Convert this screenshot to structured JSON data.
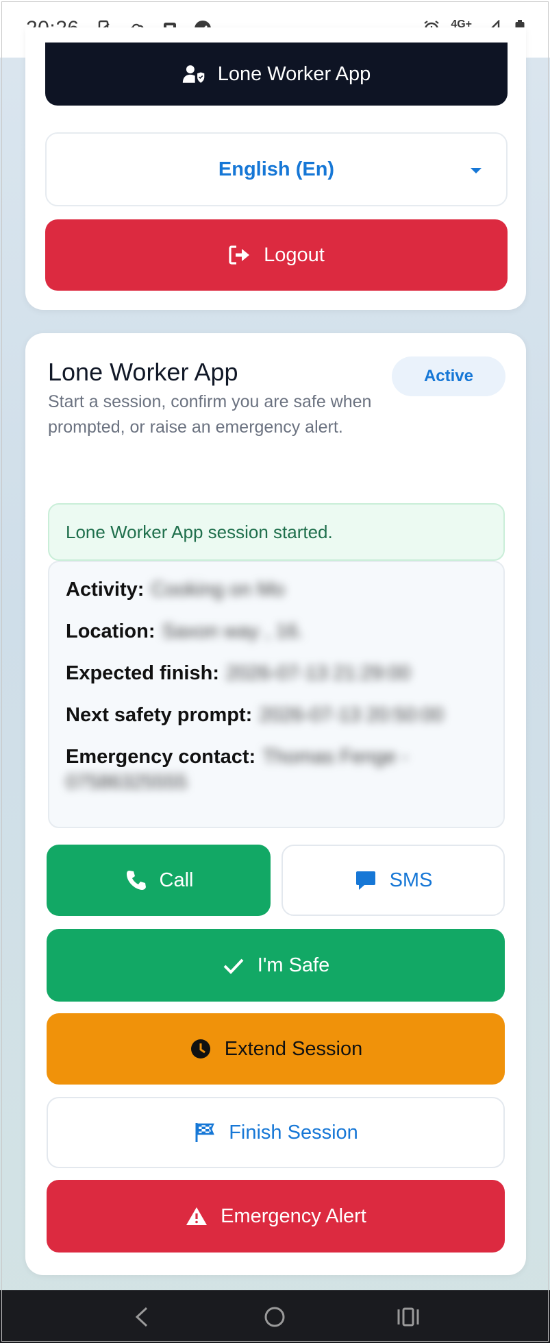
{
  "status_bar": {
    "time": "20:26",
    "network": "4G+",
    "icons": [
      "phone-sync-icon",
      "cloud-icon",
      "media-icon",
      "check-circle-icon",
      "alarm-icon",
      "signal-icon",
      "battery-icon"
    ]
  },
  "top_card": {
    "app_button_label": "Lone Worker App",
    "language_selected": "English (En)",
    "logout_label": "Logout"
  },
  "session_card": {
    "title": "Lone Worker App",
    "subtitle": "Start a session, confirm you are safe when prompted, or raise an emergency alert.",
    "status_badge": "Active",
    "notice": "Lone Worker App session started.",
    "details": [
      {
        "label": "Activity:",
        "value": "Cooking on Mo"
      },
      {
        "label": "Location:",
        "value": "Saxon way , 16."
      },
      {
        "label": "Expected finish:",
        "value": "2026-07-13 21:29:00"
      },
      {
        "label": "Next safety prompt:",
        "value": "2026-07-13 20:50:00"
      },
      {
        "label": "Emergency contact:",
        "value": "Thomas Fenge - 07586325555"
      }
    ],
    "buttons": {
      "call": "Call",
      "sms": "SMS",
      "safe": "I'm Safe",
      "extend": "Extend Session",
      "finish": "Finish Session",
      "emergency": "Emergency Alert"
    }
  },
  "colors": {
    "dark": "#0e1424",
    "red": "#dc2a40",
    "green": "#12a865",
    "orange": "#f0920a",
    "blue": "#1677d6"
  }
}
